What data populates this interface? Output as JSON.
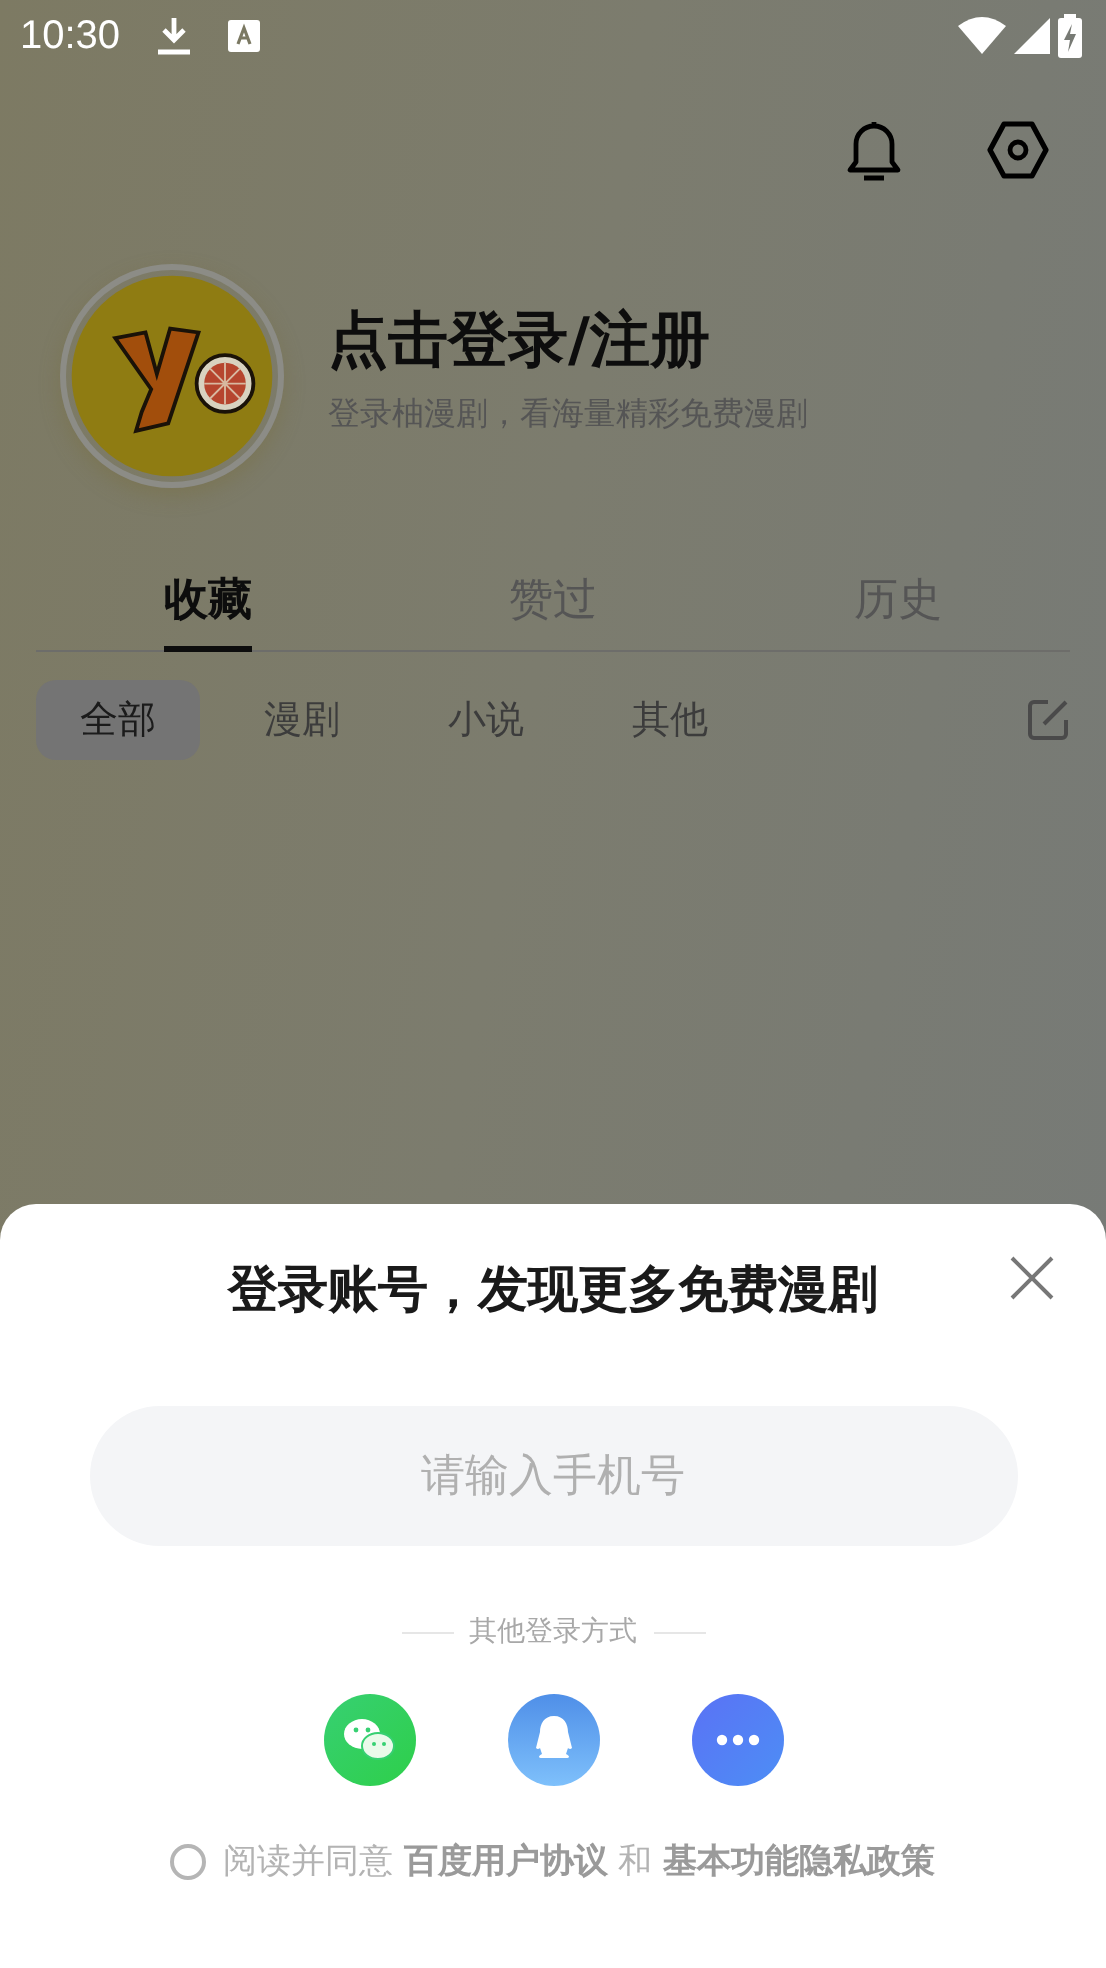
{
  "status_bar": {
    "time": "10:30"
  },
  "profile": {
    "title": "点击登录/注册",
    "subtitle": "登录柚漫剧，看海量精彩免费漫剧"
  },
  "tabs": [
    {
      "label": "收藏",
      "selected": true
    },
    {
      "label": "赞过",
      "selected": false
    },
    {
      "label": "历史",
      "selected": false
    }
  ],
  "filters": [
    {
      "label": "全部",
      "selected": true
    },
    {
      "label": "漫剧",
      "selected": false
    },
    {
      "label": "小说",
      "selected": false
    },
    {
      "label": "其他",
      "selected": false
    }
  ],
  "login_sheet": {
    "title": "登录账号，发现更多免费漫剧",
    "phone_field": {
      "placeholder": "请输入手机号"
    },
    "other_methods_label": "其他登录方式",
    "methods": [
      {
        "kind": "wechat"
      },
      {
        "kind": "qq"
      },
      {
        "kind": "more"
      }
    ],
    "agreement": {
      "checked": false,
      "parts": [
        {
          "kind": "text",
          "text": "阅读并同意 "
        },
        {
          "kind": "link",
          "text": "百度用户协议"
        },
        {
          "kind": "text",
          "text": " 和 "
        },
        {
          "kind": "link",
          "text": "基本功能隐私政策"
        }
      ]
    }
  }
}
